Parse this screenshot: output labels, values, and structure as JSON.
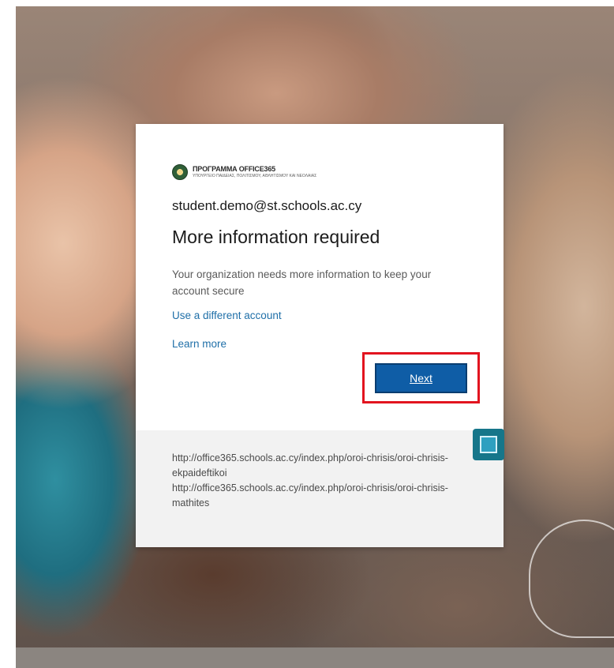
{
  "logo": {
    "title": "ΠΡΟΓΡΑΜΜΑ OFFICE365",
    "subtitle": "ΥΠΟΥΡΓΕΙΟ ΠΑΙΔΕΙΑΣ, ΠΟΛΙΤΙΣΜΟΥ, ΑΘΛΗΤΙΣΜΟΥ ΚΑΙ ΝΕΟΛΑΙΑΣ"
  },
  "account": {
    "email": "student.demo@st.schools.ac.cy"
  },
  "main": {
    "title": "More information required",
    "description": "Your organization needs more information to keep your account secure",
    "use_different_account": "Use a different account",
    "learn_more": "Learn more",
    "next_label": "Next"
  },
  "footer": {
    "terms_text": "http://office365.schools.ac.cy/index.php/oroi-chrisis/oroi-chrisis-ekpaideftikoi\nhttp://office365.schools.ac.cy/index.php/oroi-chrisis/oroi-chrisis-mathites"
  },
  "colors": {
    "primary_button": "#0f5da6",
    "link": "#1f6fa8",
    "highlight": "#e2141f",
    "marker": "#16768a"
  }
}
